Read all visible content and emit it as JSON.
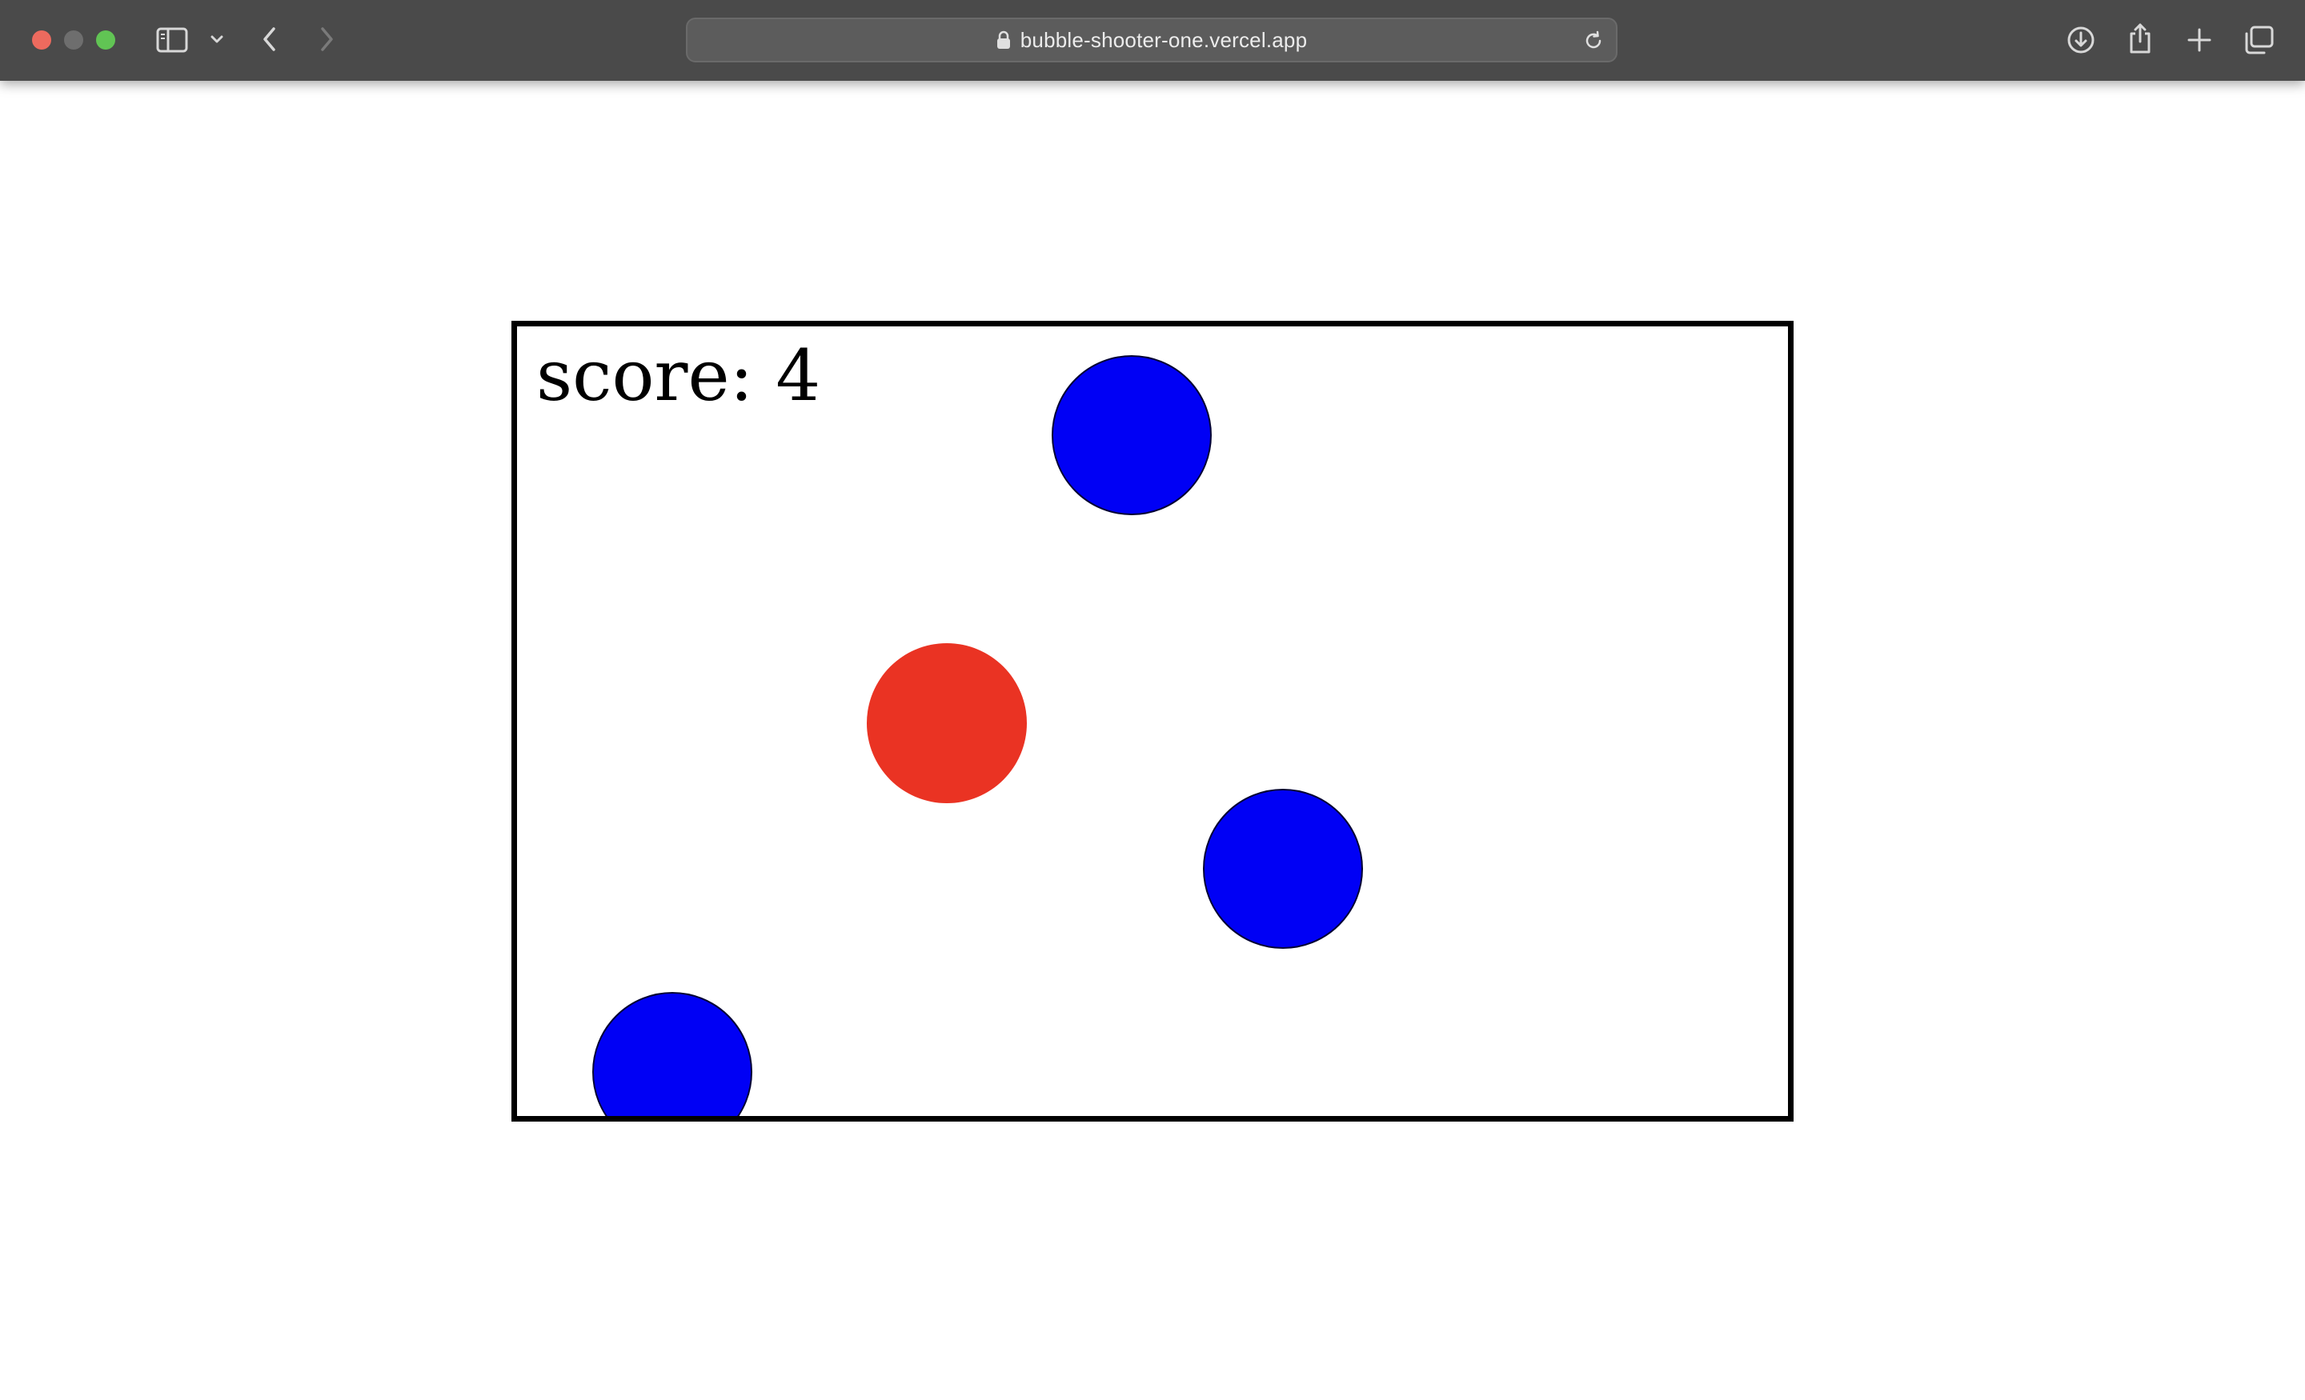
{
  "browser": {
    "url": "bubble-shooter-one.vercel.app",
    "icons": {
      "close": "close-dot",
      "minimize": "minimize-dot",
      "maximize": "maximize-dot",
      "sidebar": "sidebar-icon",
      "tab_group_menu": "chevron-down-icon",
      "back": "chevron-left-icon",
      "forward": "chevron-right-icon",
      "lock": "lock-icon",
      "reload": "reload-icon",
      "downloads": "download-icon",
      "share": "share-icon",
      "new_tab": "plus-icon",
      "tab_overview": "tabs-icon"
    }
  },
  "game": {
    "score_text": "score: 4",
    "bubbles": [
      {
        "id": "bubble-1",
        "color": "blue"
      },
      {
        "id": "bubble-2",
        "color": "red"
      },
      {
        "id": "bubble-3",
        "color": "blue"
      },
      {
        "id": "bubble-4",
        "color": "blue"
      }
    ],
    "colors": {
      "blue": "#0000f5",
      "red": "#ea3323",
      "border": "#000000"
    }
  }
}
